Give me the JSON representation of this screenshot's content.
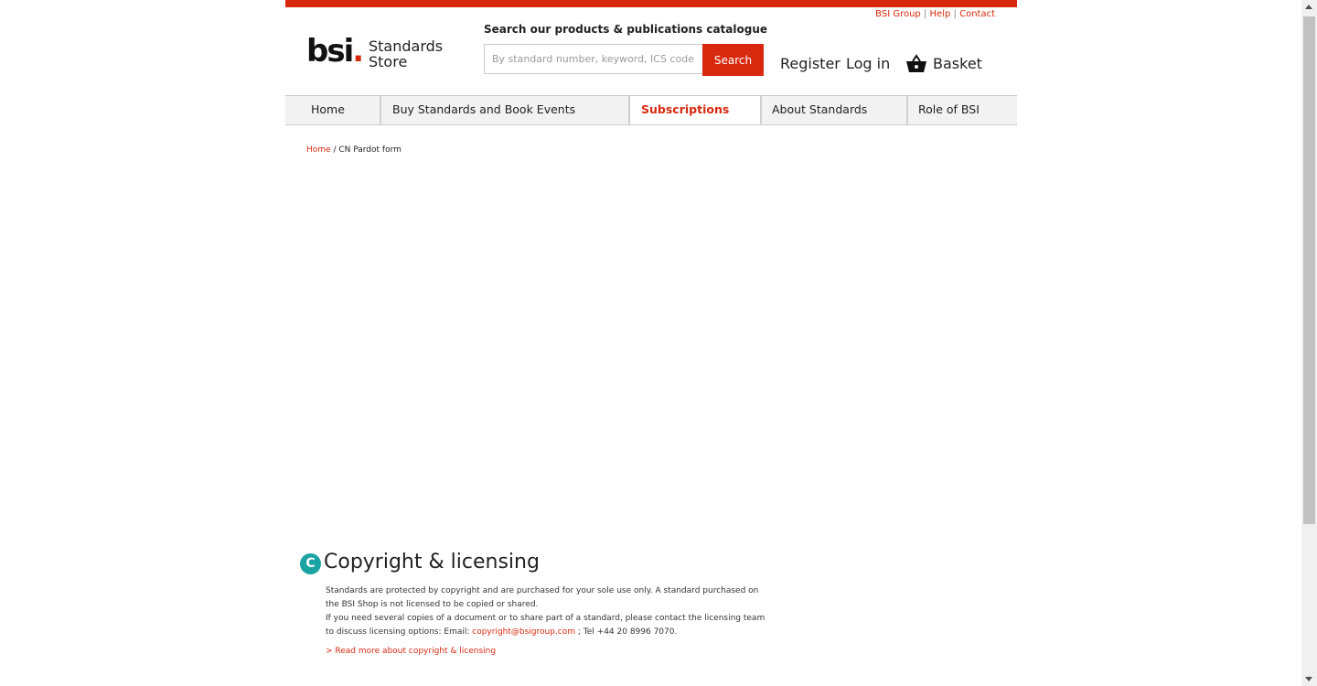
{
  "util_links": {
    "bsi_group": "BSI Group",
    "help": "Help",
    "contact": "Contact",
    "sep": "|"
  },
  "logo": {
    "bsi": "bsi",
    "dot": ".",
    "store_line1": "Standards",
    "store_line2": "Store"
  },
  "search": {
    "label": "Search our products & publications catalogue",
    "placeholder": "By standard number, keyword, ICS code, IS",
    "button": "Search"
  },
  "account": {
    "register": "Register",
    "login": "Log in",
    "basket": "Basket"
  },
  "nav": [
    {
      "label": "Home"
    },
    {
      "label": "Buy Standards and Book Events"
    },
    {
      "label": "Subscriptions",
      "active": true
    },
    {
      "label": "About Standards"
    },
    {
      "label": "Role of BSI"
    }
  ],
  "breadcrumb": {
    "home": "Home",
    "sep": " / ",
    "current": "CN Pardot form"
  },
  "copyright": {
    "icon_letter": "C",
    "title": "Copyright & licensing",
    "line1": "Standards are protected by copyright and are purchased for your sole use only. A standard purchased on",
    "line2": "the BSI Shop is not licensed to be copied or shared.",
    "line3": "If you need several copies of a document or to share part of a standard, please contact the licensing team",
    "line4_prefix": "to discuss licensing options: Email: ",
    "email": "copyright@bsigroup.com",
    "line4_suffix": " ; Tel +44 20 8996 7070.",
    "read_more": "> Read more about copyright & licensing"
  },
  "colors": {
    "accent": "#d8290f",
    "teal": "#1aa3a3"
  }
}
